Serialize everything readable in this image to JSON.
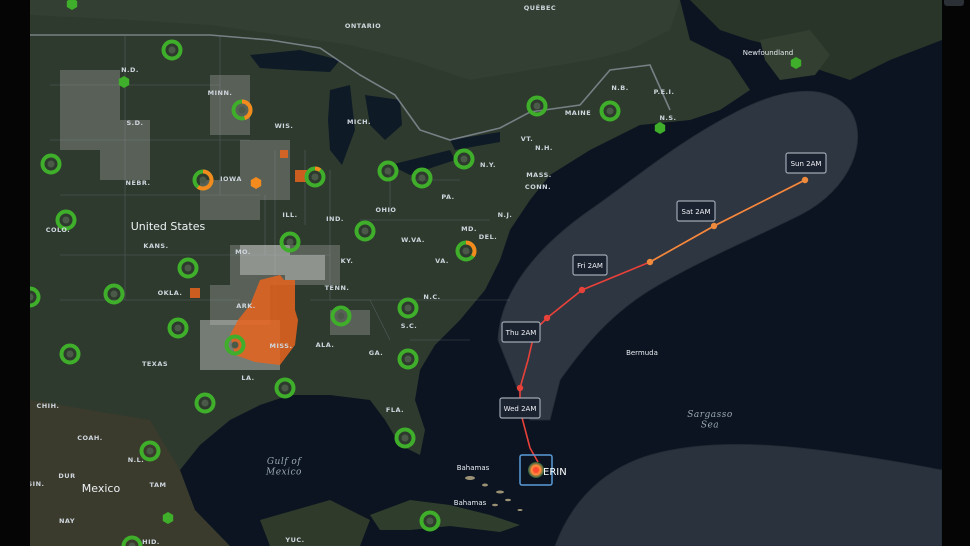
{
  "map": {
    "country_labels": [
      {
        "text": "United States"
      },
      {
        "text": "Mexico"
      }
    ],
    "region_labels": [
      "QUÉBEC",
      "ONTARIO",
      "N.D.",
      "MINN.",
      "S.D.",
      "WIS.",
      "MICH.",
      "IOWA",
      "NEBR.",
      "ILL.",
      "IND.",
      "OHIO",
      "PA.",
      "N.Y.",
      "VT.",
      "N.H.",
      "MAINE",
      "N.B.",
      "P.E.I.",
      "N.S.",
      "MASS.",
      "CONN.",
      "N.J.",
      "DEL.",
      "MD.",
      "W.VA.",
      "VA.",
      "KY.",
      "MO.",
      "KANS.",
      "COLO.",
      "OKLA.",
      "ARK.",
      "TENN.",
      "N.C.",
      "S.C.",
      "GA.",
      "ALA.",
      "MISS.",
      "LA.",
      "TEXAS",
      "FLA.",
      "CHIH.",
      "DUR",
      "TAM",
      "N.L.",
      "COAH.",
      "SIN.",
      "NAY",
      "HID.",
      "YUC."
    ],
    "place_labels": [
      "Newfoundland",
      "Bermuda",
      "Bahamas",
      "Bahamas"
    ],
    "sea_labels": [
      {
        "text": "Gulf of\nMexico"
      },
      {
        "text": "Sargasso\nSea"
      }
    ]
  },
  "storm": {
    "name": "ERIN",
    "forecast_labels": [
      "Wed 2AM",
      "Thu 2AM",
      "Fri 2AM",
      "Sat 2AM",
      "Sun 2AM"
    ]
  },
  "colors": {
    "outage_green": "#3fae2a",
    "outage_orange": "#f28a1e",
    "track_red": "#e8413a",
    "track_orange": "#f08a3c",
    "cone_fill": "#c9cfd6",
    "ocean": "#0b1420",
    "land": "#2c3a2e"
  }
}
